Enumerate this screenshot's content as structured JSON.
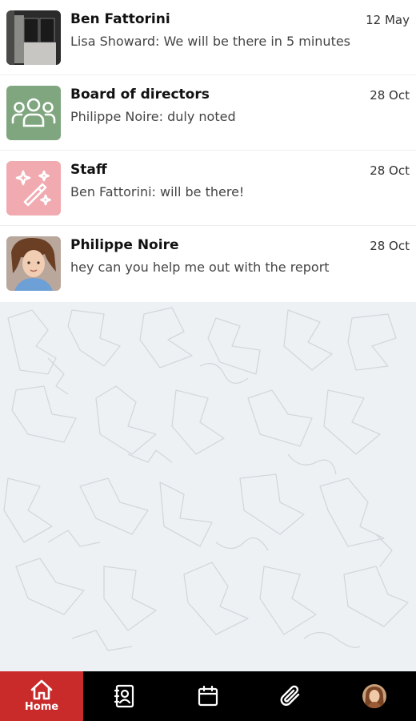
{
  "chats": [
    {
      "name": "Ben Fattorini",
      "date": "12 May",
      "preview": "Lisa Showard: We will be there in 5 minutes",
      "avatar": "photo-avatar"
    },
    {
      "name": "Board of directors",
      "date": "28 Oct",
      "preview": "Philippe Noire: duly noted",
      "avatar": "group-icon",
      "avatar_color": "#7fa67f"
    },
    {
      "name": "Staff",
      "date": "28 Oct",
      "preview": "Ben Fattorini: will be there!",
      "avatar": "magic-wand-icon",
      "avatar_color": "#f0aab0"
    },
    {
      "name": "Philippe Noire",
      "date": "28 Oct",
      "preview": "hey can you help me out with the report",
      "avatar": "photo-avatar"
    }
  ],
  "nav": {
    "items": [
      {
        "icon": "home-icon",
        "label": "Home",
        "active": true
      },
      {
        "icon": "contacts-icon"
      },
      {
        "icon": "calendar-icon"
      },
      {
        "icon": "paperclip-icon"
      },
      {
        "icon": "profile-avatar"
      }
    ],
    "active_color": "#c92a2a"
  }
}
